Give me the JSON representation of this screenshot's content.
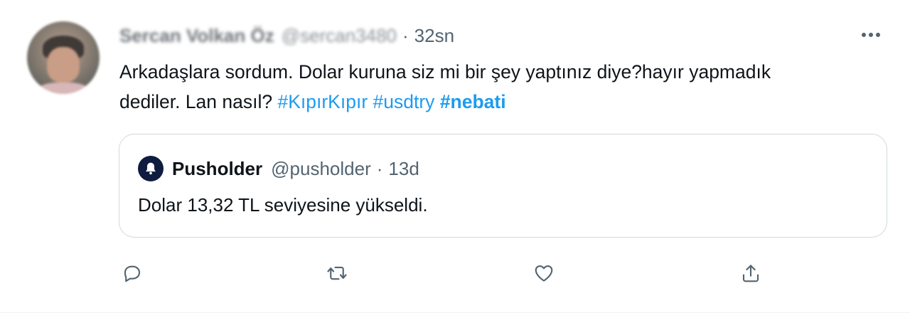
{
  "tweet": {
    "author": {
      "display_name": "Sercan Volkan Öz",
      "handle": "@sercan3480",
      "avatar": "user-photo-blurred"
    },
    "separator": "·",
    "time": "32sn",
    "more_icon": "more-horizontal-icon",
    "text_parts": {
      "line": "Arkadaşlara sordum. Dolar kuruna siz mi bir şey yaptınız diye?hayır yapmadık dediler. Lan nasıl?",
      "hashtags": [
        "#KıpırKıpır",
        "#usdtry",
        "#nebati"
      ]
    }
  },
  "quote": {
    "author": {
      "display_name": "Pusholder",
      "handle": "@pusholder",
      "avatar": "bell-icon"
    },
    "separator": "·",
    "time": "13d",
    "text": "Dolar 13,32 TL seviyesine yükseldi."
  },
  "actions": [
    {
      "name": "reply",
      "icon": "reply-icon"
    },
    {
      "name": "retweet",
      "icon": "retweet-icon"
    },
    {
      "name": "like",
      "icon": "heart-icon"
    },
    {
      "name": "share",
      "icon": "share-icon"
    }
  ],
  "colors": {
    "link": "#1d9bf0",
    "secondary_text": "#536471",
    "border": "#cfd9de",
    "primary_text": "#0f1419"
  }
}
